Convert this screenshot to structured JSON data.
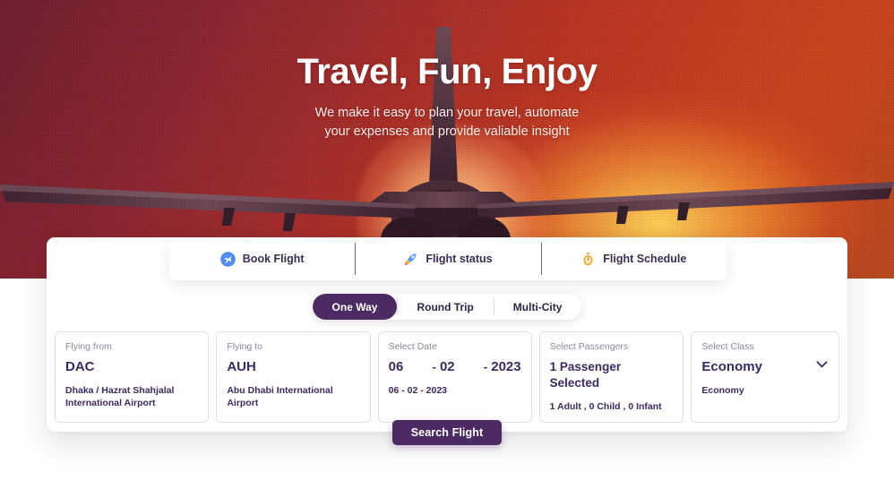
{
  "hero": {
    "title": "Travel, Fun, Enjoy",
    "subtitle_line1": "We make it easy to plan your travel, automate",
    "subtitle_line2": "your expenses and provide valiable insight",
    "background_colors": {
      "maroon": "#6f1f2e",
      "red": "#ab3028",
      "orange": "#c9441d",
      "sun_glow": "#ffd65a"
    }
  },
  "tabs": [
    {
      "label": "Book Flight",
      "icon": "airplane-badge-icon",
      "active": true
    },
    {
      "label": "Flight status",
      "icon": "rocket-icon",
      "active": false
    },
    {
      "label": "Flight Schedule",
      "icon": "stopwatch-icon",
      "active": false
    }
  ],
  "trip_types": [
    {
      "label": "One Way",
      "active": true
    },
    {
      "label": "Round Trip",
      "active": false
    },
    {
      "label": "Multi-City",
      "active": false
    }
  ],
  "fields": {
    "from": {
      "label": "Flying from",
      "code": "DAC",
      "airport": "Dhaka / Hazrat Shahjalal International Airport"
    },
    "to": {
      "label": "Flying to",
      "code": "AUH",
      "airport": "Abu Dhabi International Airport"
    },
    "date": {
      "label": "Select Date",
      "day": "06",
      "month": "02",
      "year": "2023",
      "separator": "-",
      "summary": "06 - 02 - 2023"
    },
    "passengers": {
      "label": "Select Passengers",
      "value": "1 Passenger Selected",
      "breakdown": "1 Adult , 0 Child , 0 Infant"
    },
    "travel_class": {
      "label": "Select Class",
      "value": "Economy",
      "sub": "Economy",
      "icon": "chevron-down-icon"
    }
  },
  "actions": {
    "search_label": "Search Flight",
    "accent_color": "#4c2a63"
  }
}
